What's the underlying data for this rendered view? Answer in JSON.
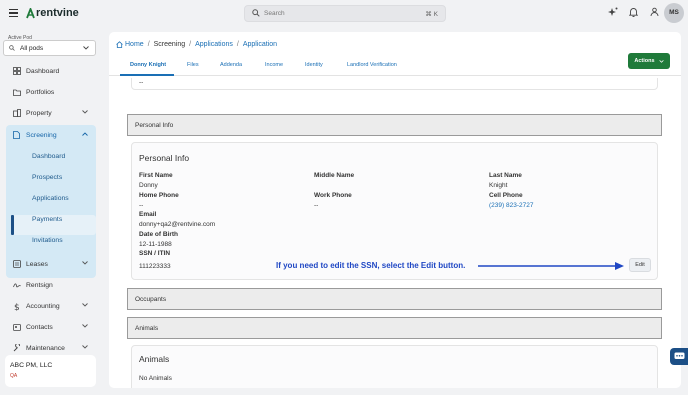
{
  "brand": {
    "name": "rentvine"
  },
  "search": {
    "placeholder": "Search",
    "shortcut": "⌘ K"
  },
  "user": {
    "initials": "MS"
  },
  "sidebar": {
    "pod_label": "Active Pod",
    "pod_value": "All pods",
    "items": [
      {
        "label": "Dashboard",
        "icon": "dashboard-icon"
      },
      {
        "label": "Portfolios",
        "icon": "folder-icon"
      },
      {
        "label": "Property",
        "icon": "building-icon",
        "expandable": true
      },
      {
        "label": "Screening",
        "icon": "document-icon",
        "expanded": true
      },
      {
        "label": "Leases",
        "icon": "leases-icon",
        "expandable": true
      },
      {
        "label": "Rentsign",
        "icon": "signature-icon"
      },
      {
        "label": "Accounting",
        "icon": "accounting-icon",
        "expandable": true
      },
      {
        "label": "Contacts",
        "icon": "contacts-icon",
        "expandable": true
      },
      {
        "label": "Maintenance",
        "icon": "wrench-icon",
        "expandable": true
      }
    ],
    "screening_sub": [
      "Dashboard",
      "Prospects",
      "Applications",
      "Payments",
      "Invitations"
    ],
    "active_sub": "Applications",
    "company": {
      "name": "ABC PM, LLC",
      "sub": "QA"
    }
  },
  "breadcrumb": {
    "home": "Home",
    "sep": "/",
    "screening": "Screening",
    "applications": "Applications",
    "current": "Application"
  },
  "tabs": [
    "Donny Knight",
    "Files",
    "Addenda",
    "Income",
    "Identity",
    "Landlord Verification"
  ],
  "actions_label": "Actions",
  "prev_value": "--",
  "sections": {
    "personal_info_bar": "Personal Info",
    "occupants_bar": "Occupants",
    "animals_bar": "Animals"
  },
  "personal_info": {
    "title": "Personal Info",
    "first_name_label": "First Name",
    "first_name": "Donny",
    "middle_name_label": "Middle Name",
    "last_name_label": "Last Name",
    "last_name": "Knight",
    "home_phone_label": "Home Phone",
    "home_phone": "--",
    "work_phone_label": "Work Phone",
    "work_phone": "--",
    "cell_phone_label": "Cell Phone",
    "cell_phone": "(239) 823-2727",
    "email_label": "Email",
    "email": "donny+qa2@rentvine.com",
    "dob_label": "Date of Birth",
    "dob": "12-11-1988",
    "ssn_label": "SSN / ITIN",
    "ssn": "111223333",
    "edit_label": "Edit"
  },
  "annotation": "If you need to edit the SSN, select the Edit button.",
  "animals": {
    "title": "Animals",
    "empty": "No Animals"
  },
  "colors": {
    "accent": "#1a6fb5",
    "actions": "#1f7a3a",
    "annotation": "#1f47c4",
    "sidebar_active_bg": "#d4e9f5"
  }
}
